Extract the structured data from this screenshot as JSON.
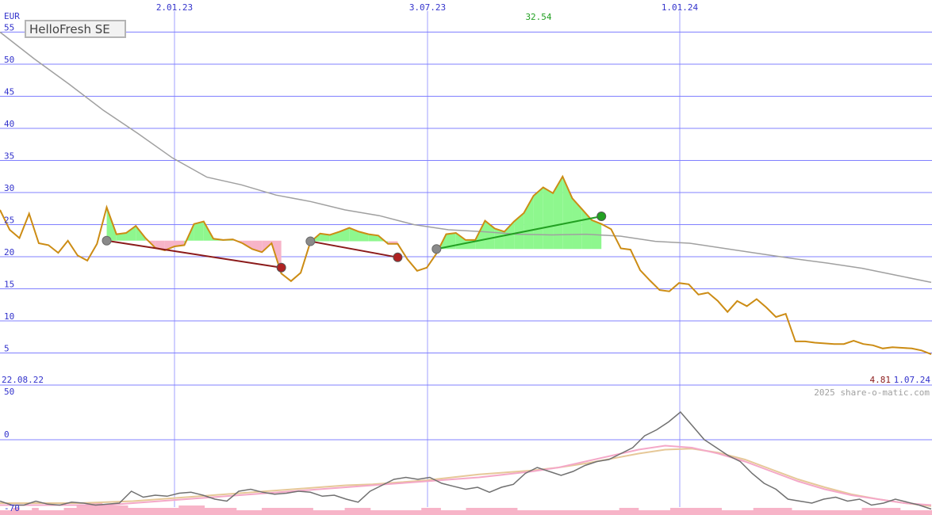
{
  "chart_data": {
    "type": "line",
    "title": "HelloFresh SE",
    "currency": "EUR",
    "date_start": "22.08.22",
    "date_end": "1.07.24",
    "last_value": "4.81",
    "peak_label": "32.54",
    "copyright": "2025 share-o-matic.com",
    "x_ticks": [
      "2.01.23",
      "3.07.23",
      "1.01.24"
    ],
    "price_y_ticks": [
      55,
      50,
      45,
      40,
      35,
      30,
      25,
      20,
      15,
      10,
      5
    ],
    "price_ylim": [
      0,
      55
    ],
    "osc_y_ticks": [
      "50",
      "0",
      "-70"
    ],
    "osc_ylim": [
      -70,
      50
    ],
    "grid": true,
    "colors": {
      "price": "#cc8c14",
      "ma_long": "#a0a0a0",
      "up_fill": "#8ef78e",
      "down_fill": "#f7b4c8",
      "loss_line": "#8b1a1a",
      "gain_line": "#22a022",
      "grid": "#8080ff",
      "axis_text": "#3333cc",
      "osc_main": "#707070",
      "osc_sig1": "#f4a8c8",
      "osc_sig2": "#e6c898",
      "volume": "#f7b4c8"
    },
    "price_series": [
      27.3,
      24.2,
      22.9,
      26.7,
      22.1,
      21.8,
      20.6,
      22.5,
      20.2,
      19.4,
      22.0,
      27.7,
      23.5,
      23.7,
      24.8,
      22.9,
      21.4,
      21.0,
      21.6,
      21.8,
      25.1,
      25.5,
      22.8,
      22.6,
      22.7,
      22.1,
      21.2,
      20.7,
      22.1,
      17.4,
      16.2,
      17.5,
      22.3,
      23.6,
      23.4,
      23.9,
      24.5,
      23.9,
      23.5,
      23.3,
      22.0,
      22.0,
      19.6,
      17.8,
      18.3,
      20.5,
      23.5,
      23.7,
      22.6,
      22.6,
      25.6,
      24.4,
      23.9,
      25.5,
      26.8,
      29.5,
      30.8,
      29.9,
      32.5,
      29.1,
      27.4,
      25.7,
      25.1,
      24.3,
      21.3,
      21.1,
      17.9,
      16.3,
      14.8,
      14.6,
      15.9,
      15.7,
      14.1,
      14.4,
      13.1,
      11.4,
      13.1,
      12.3,
      13.4,
      12.1,
      10.6,
      11.1,
      6.8,
      6.8,
      6.6,
      6.5,
      6.4,
      6.4,
      6.9,
      6.4,
      6.2,
      5.7,
      5.9,
      5.8,
      5.7,
      5.4,
      4.8
    ],
    "ma_long_series": [
      55.0,
      50.8,
      46.9,
      42.8,
      39.2,
      35.4,
      32.4,
      31.2,
      29.6,
      28.6,
      27.3,
      26.4,
      25.0,
      24.2,
      23.9,
      23.5,
      23.4,
      23.5,
      23.2,
      22.4,
      22.1,
      21.3,
      20.5,
      19.7,
      19.0,
      18.2,
      17.1,
      16.0
    ],
    "trades": [
      {
        "buy_date": "20.10.22",
        "buy_price": 22.5,
        "sell_date": "10.04.23",
        "sell_price": 18.3,
        "result": "loss"
      },
      {
        "buy_date": "1.05.23",
        "buy_price": 22.4,
        "sell_date": "20.06.23",
        "sell_price": 19.9,
        "result": "loss"
      },
      {
        "buy_date": "3.07.23",
        "buy_price": 21.2,
        "sell_date": "1.11.23",
        "sell_price": 26.3,
        "result": "gain"
      }
    ],
    "osc_main_series": [
      -62,
      -66,
      -66,
      -62,
      -65,
      -66,
      -63,
      -64,
      -66,
      -65,
      -64,
      -52,
      -58,
      -56,
      -57,
      -54,
      -53,
      -56,
      -60,
      -62,
      -52,
      -50,
      -53,
      -55,
      -54,
      -52,
      -53,
      -57,
      -56,
      -60,
      -63,
      -52,
      -46,
      -40,
      -38,
      -40,
      -38,
      -44,
      -47,
      -50,
      -48,
      -53,
      -48,
      -45,
      -34,
      -28,
      -32,
      -36,
      -32,
      -26,
      -22,
      -20,
      -14,
      -8,
      4,
      10,
      18,
      28,
      14,
      0,
      -8,
      -16,
      -22,
      -34,
      -44,
      -50,
      -60,
      -62,
      -64,
      -60,
      -58,
      -62,
      -60,
      -66,
      -64,
      -60,
      -63,
      -66,
      -70
    ],
    "osc_sig1_series": [
      -66,
      -66,
      -66,
      -66,
      -66,
      -64,
      -62,
      -60,
      -58,
      -56,
      -54,
      -52,
      -50,
      -48,
      -46,
      -44,
      -42,
      -40,
      -38,
      -35,
      -32,
      -28,
      -22,
      -16,
      -10,
      -6,
      -8,
      -14,
      -22,
      -32,
      -42,
      -50,
      -56,
      -60,
      -64,
      -66
    ],
    "osc_sig2_series": [
      -64,
      -64,
      -64,
      -64,
      -63,
      -62,
      -60,
      -58,
      -56,
      -54,
      -52,
      -50,
      -48,
      -46,
      -45,
      -43,
      -41,
      -38,
      -35,
      -33,
      -31,
      -28,
      -24,
      -19,
      -14,
      -10,
      -9,
      -13,
      -20,
      -30,
      -40,
      -48,
      -55,
      -60,
      -64,
      -67
    ],
    "volume_series": [
      2,
      2,
      3,
      2,
      2,
      3,
      2,
      2,
      2,
      2,
      3,
      3,
      4,
      4,
      5,
      5,
      4,
      4,
      4,
      4,
      3,
      3,
      3,
      3,
      3,
      3,
      3,
      3,
      4,
      4,
      4,
      4,
      3,
      3,
      3,
      3,
      3,
      2,
      2,
      2,
      2,
      3,
      3,
      3,
      3,
      3,
      3,
      3,
      3,
      2,
      2,
      2,
      2,
      2,
      3,
      3,
      3,
      3,
      2,
      2,
      2,
      2,
      2,
      2,
      2,
      2,
      3,
      3,
      3,
      2,
      2,
      2,
      2,
      3,
      3,
      3,
      3,
      3,
      3,
      3,
      3,
      2,
      2,
      2,
      2,
      2,
      2,
      2,
      2,
      2,
      2,
      2,
      2,
      2,
      2,
      2,
      2,
      3,
      3,
      3,
      2,
      2,
      2,
      2,
      2,
      3,
      3,
      3,
      3,
      3,
      3,
      3,
      3,
      2,
      2,
      2,
      2,
      2,
      3,
      3,
      3,
      3,
      3,
      3,
      2,
      2,
      2,
      2,
      2,
      2,
      2,
      2,
      2,
      2,
      2,
      3,
      3,
      3,
      3,
      3,
      3,
      2,
      2,
      2,
      2,
      2
    ]
  }
}
